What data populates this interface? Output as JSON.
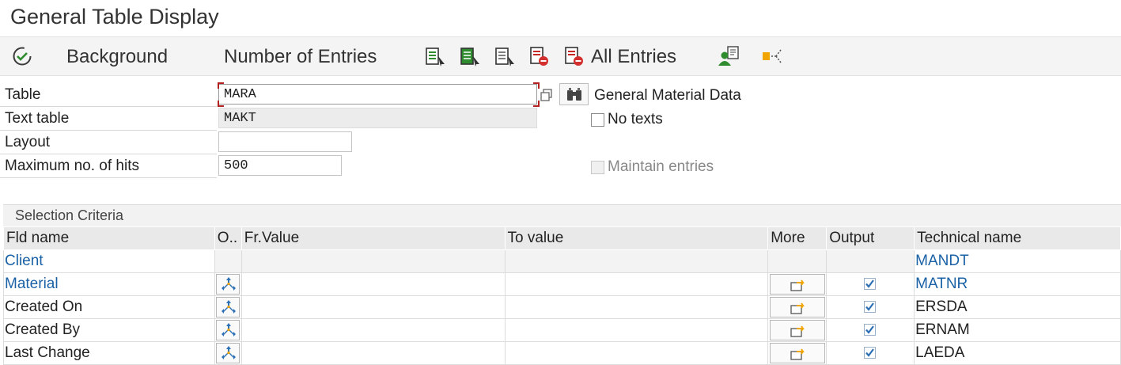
{
  "window": {
    "title": "General Table Display"
  },
  "toolbar": {
    "background_label": "Background",
    "number_of_entries_label": "Number of Entries",
    "all_entries_label": "All Entries"
  },
  "form": {
    "table_label": "Table",
    "table_value": "MARA",
    "table_description": "General Material Data",
    "text_table_label": "Text table",
    "text_table_value": "MAKT",
    "no_texts_label": "No texts",
    "layout_label": "Layout",
    "layout_value": "",
    "max_hits_label": "Maximum no. of hits",
    "max_hits_value": "500",
    "maintain_entries_label": "Maintain entries"
  },
  "selection": {
    "section_title": "Selection Criteria",
    "headers": {
      "fld_name": "Fld name",
      "option": "O..",
      "from_value": "Fr.Value",
      "to_value": "To value",
      "more": "More",
      "output": "Output",
      "technical_name": "Technical name"
    },
    "rows": [
      {
        "fld_name": "Client",
        "technical_name": "MANDT",
        "key": true,
        "output": null,
        "from": "",
        "to": ""
      },
      {
        "fld_name": "Material",
        "technical_name": "MATNR",
        "key": true,
        "output": true,
        "from": "",
        "to": ""
      },
      {
        "fld_name": "Created On",
        "technical_name": "ERSDA",
        "key": false,
        "output": true,
        "from": "",
        "to": ""
      },
      {
        "fld_name": "Created By",
        "technical_name": "ERNAM",
        "key": false,
        "output": true,
        "from": "",
        "to": ""
      },
      {
        "fld_name": "Last Change",
        "technical_name": "LAEDA",
        "key": false,
        "output": true,
        "from": "",
        "to": ""
      }
    ]
  },
  "colors": {
    "key_field": "#1a61a6",
    "focus_corner": "#b32020",
    "check": "#2b6fb5"
  }
}
